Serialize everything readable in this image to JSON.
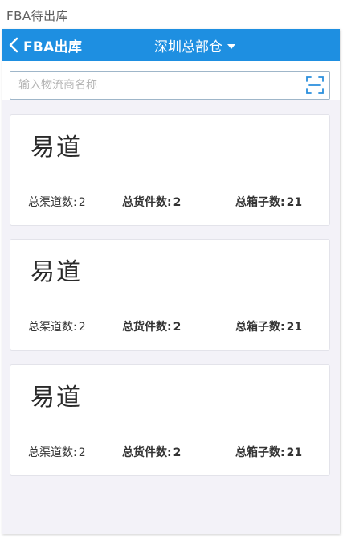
{
  "page_caption": "FBA待出库",
  "header": {
    "back_label": "FBA出库",
    "warehouse": "深圳总部仓",
    "back_icon": "chevron-left-icon",
    "dropdown_icon": "caret-down-icon",
    "color": "#1e8fe1"
  },
  "search": {
    "placeholder": "输入物流商名称",
    "value": "",
    "scan_icon": "scan-icon"
  },
  "cards": [
    {
      "title": "易道",
      "channels_label": "总渠道数:",
      "channels_value": "2",
      "goods_label": "总货件数:",
      "goods_value": "2",
      "boxes_label": "总箱子数:",
      "boxes_value": "21"
    },
    {
      "title": "易道",
      "channels_label": "总渠道数:",
      "channels_value": "2",
      "goods_label": "总货件数:",
      "goods_value": "2",
      "boxes_label": "总箱子数:",
      "boxes_value": "21"
    },
    {
      "title": "易道",
      "channels_label": "总渠道数:",
      "channels_value": "2",
      "goods_label": "总货件数:",
      "goods_value": "2",
      "boxes_label": "总箱子数:",
      "boxes_value": "21"
    }
  ]
}
